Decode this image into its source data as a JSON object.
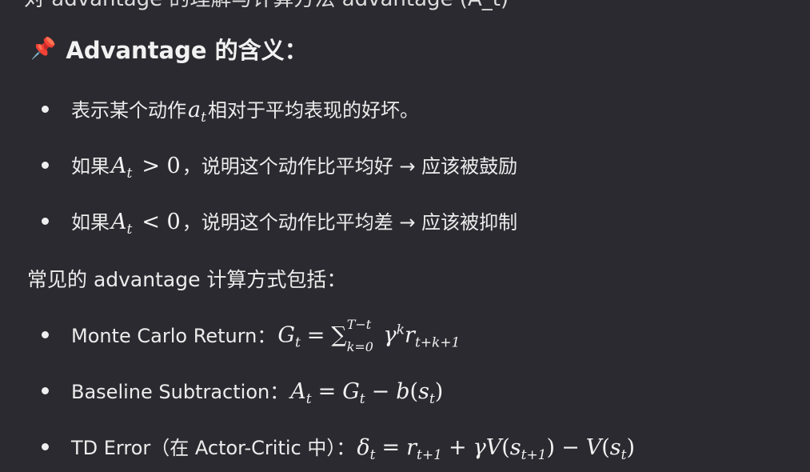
{
  "top_fragment": "对 advantage 的理解与计算方法 advantage (A_t)",
  "heading": {
    "icon": "pushpin-icon",
    "title": "Advantage 的含义："
  },
  "meaning_items": [
    {
      "prefix": "表示某个动作",
      "math": "a",
      "sub": "t",
      "suffix": "相对于平均表现的好坏。"
    },
    {
      "prefix": "如果",
      "math": "A",
      "sub": "t",
      "rel": "> 0",
      "suffix": "，说明这个动作比平均好 → 应该被鼓励"
    },
    {
      "prefix": "如果",
      "math": "A",
      "sub": "t",
      "rel": "< 0",
      "suffix": "，说明这个动作比平均差 → 应该被抑制"
    }
  ],
  "methods_intro": "常见的 advantage 计算方式包括：",
  "methods": [
    {
      "label": "Monte Carlo Return：",
      "formula": "G_t = Σ_{k=0}^{T−t} γ^k r_{t+k+1}"
    },
    {
      "label": "Baseline Subtraction：",
      "formula": "A_t = G_t − b(s_t)"
    },
    {
      "label": "TD Error（在 Actor-Critic 中）：",
      "formula": "δ_t = r_{t+1} + γV(s_{t+1}) − V(s_t)"
    }
  ]
}
